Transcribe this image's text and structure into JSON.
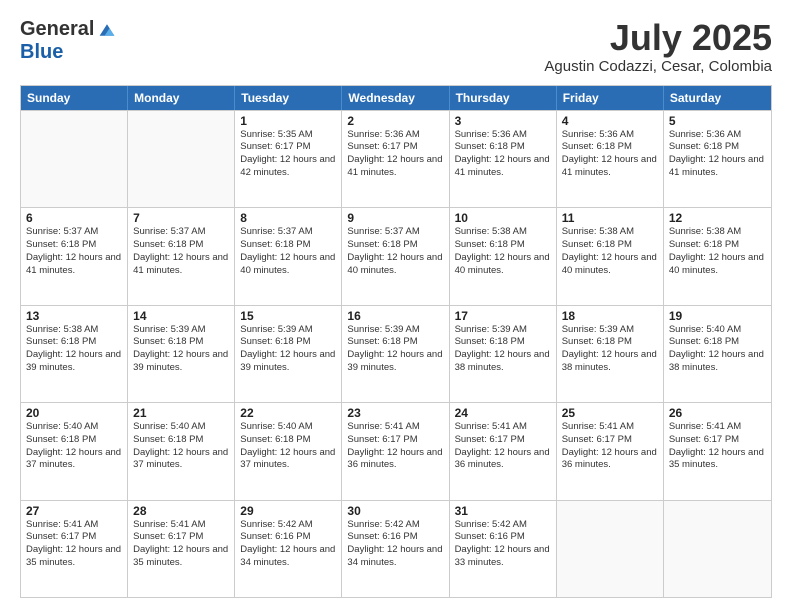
{
  "logo": {
    "general": "General",
    "blue": "Blue"
  },
  "title": "July 2025",
  "subtitle": "Agustin Codazzi, Cesar, Colombia",
  "days_of_week": [
    "Sunday",
    "Monday",
    "Tuesday",
    "Wednesday",
    "Thursday",
    "Friday",
    "Saturday"
  ],
  "weeks": [
    [
      {
        "day": "",
        "info": ""
      },
      {
        "day": "",
        "info": ""
      },
      {
        "day": "1",
        "info": "Sunrise: 5:35 AM\nSunset: 6:17 PM\nDaylight: 12 hours and 42 minutes."
      },
      {
        "day": "2",
        "info": "Sunrise: 5:36 AM\nSunset: 6:17 PM\nDaylight: 12 hours and 41 minutes."
      },
      {
        "day": "3",
        "info": "Sunrise: 5:36 AM\nSunset: 6:18 PM\nDaylight: 12 hours and 41 minutes."
      },
      {
        "day": "4",
        "info": "Sunrise: 5:36 AM\nSunset: 6:18 PM\nDaylight: 12 hours and 41 minutes."
      },
      {
        "day": "5",
        "info": "Sunrise: 5:36 AM\nSunset: 6:18 PM\nDaylight: 12 hours and 41 minutes."
      }
    ],
    [
      {
        "day": "6",
        "info": "Sunrise: 5:37 AM\nSunset: 6:18 PM\nDaylight: 12 hours and 41 minutes."
      },
      {
        "day": "7",
        "info": "Sunrise: 5:37 AM\nSunset: 6:18 PM\nDaylight: 12 hours and 41 minutes."
      },
      {
        "day": "8",
        "info": "Sunrise: 5:37 AM\nSunset: 6:18 PM\nDaylight: 12 hours and 40 minutes."
      },
      {
        "day": "9",
        "info": "Sunrise: 5:37 AM\nSunset: 6:18 PM\nDaylight: 12 hours and 40 minutes."
      },
      {
        "day": "10",
        "info": "Sunrise: 5:38 AM\nSunset: 6:18 PM\nDaylight: 12 hours and 40 minutes."
      },
      {
        "day": "11",
        "info": "Sunrise: 5:38 AM\nSunset: 6:18 PM\nDaylight: 12 hours and 40 minutes."
      },
      {
        "day": "12",
        "info": "Sunrise: 5:38 AM\nSunset: 6:18 PM\nDaylight: 12 hours and 40 minutes."
      }
    ],
    [
      {
        "day": "13",
        "info": "Sunrise: 5:38 AM\nSunset: 6:18 PM\nDaylight: 12 hours and 39 minutes."
      },
      {
        "day": "14",
        "info": "Sunrise: 5:39 AM\nSunset: 6:18 PM\nDaylight: 12 hours and 39 minutes."
      },
      {
        "day": "15",
        "info": "Sunrise: 5:39 AM\nSunset: 6:18 PM\nDaylight: 12 hours and 39 minutes."
      },
      {
        "day": "16",
        "info": "Sunrise: 5:39 AM\nSunset: 6:18 PM\nDaylight: 12 hours and 39 minutes."
      },
      {
        "day": "17",
        "info": "Sunrise: 5:39 AM\nSunset: 6:18 PM\nDaylight: 12 hours and 38 minutes."
      },
      {
        "day": "18",
        "info": "Sunrise: 5:39 AM\nSunset: 6:18 PM\nDaylight: 12 hours and 38 minutes."
      },
      {
        "day": "19",
        "info": "Sunrise: 5:40 AM\nSunset: 6:18 PM\nDaylight: 12 hours and 38 minutes."
      }
    ],
    [
      {
        "day": "20",
        "info": "Sunrise: 5:40 AM\nSunset: 6:18 PM\nDaylight: 12 hours and 37 minutes."
      },
      {
        "day": "21",
        "info": "Sunrise: 5:40 AM\nSunset: 6:18 PM\nDaylight: 12 hours and 37 minutes."
      },
      {
        "day": "22",
        "info": "Sunrise: 5:40 AM\nSunset: 6:18 PM\nDaylight: 12 hours and 37 minutes."
      },
      {
        "day": "23",
        "info": "Sunrise: 5:41 AM\nSunset: 6:17 PM\nDaylight: 12 hours and 36 minutes."
      },
      {
        "day": "24",
        "info": "Sunrise: 5:41 AM\nSunset: 6:17 PM\nDaylight: 12 hours and 36 minutes."
      },
      {
        "day": "25",
        "info": "Sunrise: 5:41 AM\nSunset: 6:17 PM\nDaylight: 12 hours and 36 minutes."
      },
      {
        "day": "26",
        "info": "Sunrise: 5:41 AM\nSunset: 6:17 PM\nDaylight: 12 hours and 35 minutes."
      }
    ],
    [
      {
        "day": "27",
        "info": "Sunrise: 5:41 AM\nSunset: 6:17 PM\nDaylight: 12 hours and 35 minutes."
      },
      {
        "day": "28",
        "info": "Sunrise: 5:41 AM\nSunset: 6:17 PM\nDaylight: 12 hours and 35 minutes."
      },
      {
        "day": "29",
        "info": "Sunrise: 5:42 AM\nSunset: 6:16 PM\nDaylight: 12 hours and 34 minutes."
      },
      {
        "day": "30",
        "info": "Sunrise: 5:42 AM\nSunset: 6:16 PM\nDaylight: 12 hours and 34 minutes."
      },
      {
        "day": "31",
        "info": "Sunrise: 5:42 AM\nSunset: 6:16 PM\nDaylight: 12 hours and 33 minutes."
      },
      {
        "day": "",
        "info": ""
      },
      {
        "day": "",
        "info": ""
      }
    ]
  ]
}
